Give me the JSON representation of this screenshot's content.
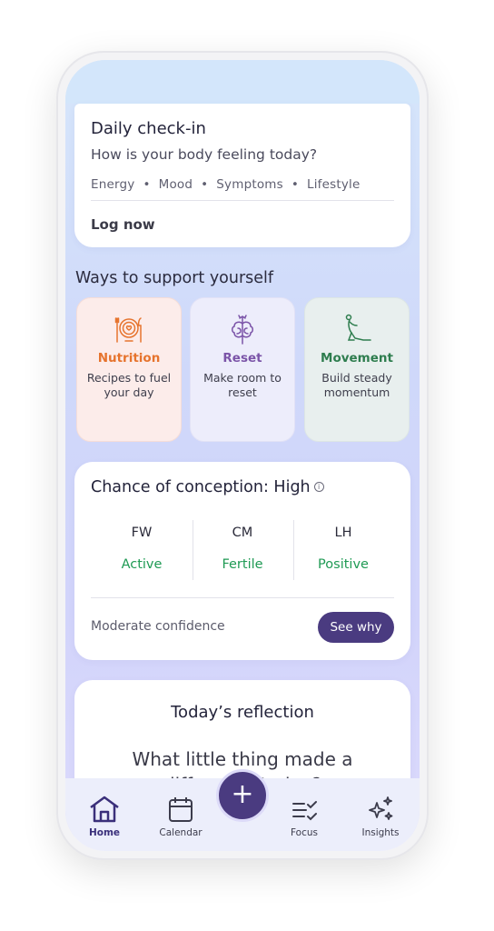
{
  "checkin": {
    "title": "Daily check-in",
    "question": "How is your body feeling today?",
    "tags": "Energy  •  Mood  •  Symptoms  •  Lifestyle",
    "action": "Log now"
  },
  "support": {
    "title": "Ways to support yourself",
    "tiles": [
      {
        "icon": "nutrition-icon",
        "title": "Nutrition",
        "desc": "Recipes to fuel your day",
        "color": "#e6742e"
      },
      {
        "icon": "brain-icon",
        "title": "Reset",
        "desc": "Make room to reset",
        "color": "#7b54a8"
      },
      {
        "icon": "yoga-pose-icon",
        "title": "Movement",
        "desc": "Build steady momentum",
        "color": "#2e7d4e"
      }
    ]
  },
  "conception": {
    "label": "Chance of conception:",
    "level": "High",
    "info_glyph": "i",
    "metrics": [
      {
        "key": "FW",
        "value": "Active"
      },
      {
        "key": "CM",
        "value": "Fertile"
      },
      {
        "key": "LH",
        "value": "Positive"
      }
    ],
    "confidence": "Moderate confidence",
    "button": "See why",
    "positive_color": "#1f9a54"
  },
  "reflection": {
    "title": "Today’s reflection",
    "prompt": "What little thing made a difference today?"
  },
  "tabbar": {
    "tabs": [
      {
        "label": "Home",
        "icon": "home-icon",
        "active": true
      },
      {
        "label": "Calendar",
        "icon": "calendar-icon",
        "active": false
      },
      {
        "label": "Focus",
        "icon": "focus-icon",
        "active": false
      },
      {
        "label": "Insights",
        "icon": "sparkles-icon",
        "active": false
      }
    ],
    "fab_glyph": "+"
  },
  "colors": {
    "accent": "#4a3b80"
  }
}
